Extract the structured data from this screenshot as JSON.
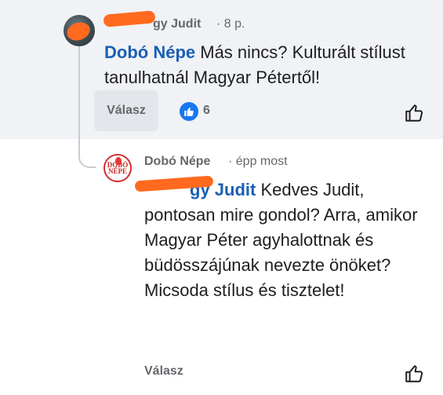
{
  "colors": {
    "mention": "#1a5fb4",
    "muted": "#65676b",
    "like_blue": "#1877f2",
    "redaction": "#ff6a1f"
  },
  "comment1": {
    "author_visible": "gy Judit",
    "time": "· 8 p.",
    "mention": "Dobó Népe",
    "text": " Más nincs? Kulturált stílust tanulhatnál Magyar Pétertől!",
    "reply_label": "Válasz",
    "like_count": "6",
    "icons": {
      "avatar": "user-avatar-redacted",
      "like_badge": "thumbs-up-icon",
      "like_button": "thumbs-up-outline-icon"
    }
  },
  "comment2": {
    "author": "Dobó Népe",
    "time": "· épp most",
    "mention_visible": "gy Judit",
    "text": " Kedves Judit, pontosan mire gondol? Arra, amikor Magyar Péter agyhalottnak és büdösszájúnak nevezte önöket? Micsoda stílus és tisztelet!",
    "reply_label": "Válasz",
    "avatar_logo": "DOBÓ NÉPE",
    "icons": {
      "avatar": "dobo-nepe-logo-avatar",
      "like_button": "thumbs-up-outline-icon"
    }
  }
}
